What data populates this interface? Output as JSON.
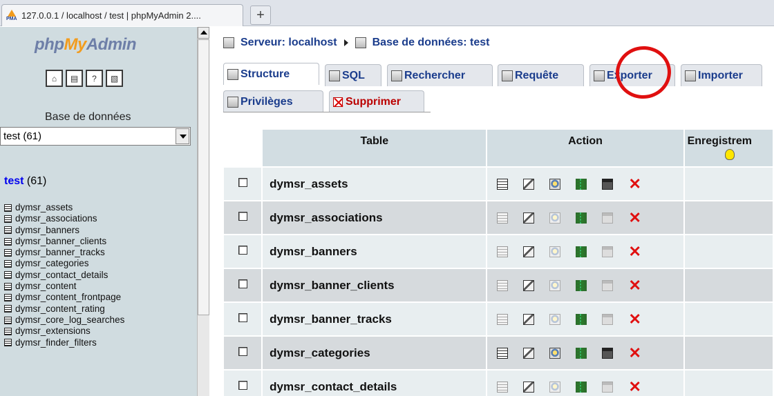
{
  "browser": {
    "tab_title": "127.0.0.1 / localhost / test | phpMyAdmin 2....",
    "favicon_text": "PMA",
    "new_tab_label": "+"
  },
  "left": {
    "logo_php": "php",
    "logo_my": "My",
    "logo_admin": "Admin",
    "toolbar_icons": [
      "home-icon",
      "sql-query-icon",
      "help-icon",
      "documentation-icon"
    ],
    "db_label": "Base de données",
    "db_select_value": "test (61)",
    "db_name": "test",
    "db_count": "(61)",
    "tables": [
      "dymsr_assets",
      "dymsr_associations",
      "dymsr_banners",
      "dymsr_banner_clients",
      "dymsr_banner_tracks",
      "dymsr_categories",
      "dymsr_contact_details",
      "dymsr_content",
      "dymsr_content_frontpage",
      "dymsr_content_rating",
      "dymsr_core_log_searches",
      "dymsr_extensions",
      "dymsr_finder_filters"
    ]
  },
  "breadcrumb": {
    "server": "Serveur: localhost",
    "database": "Base de données: test"
  },
  "tabs": {
    "structure": "Structure",
    "sql": "SQL",
    "search": "Rechercher",
    "query": "Requête",
    "export": "Exporter",
    "import": "Importer",
    "privileges": "Privilèges",
    "drop": "Supprimer"
  },
  "table": {
    "col_table": "Table",
    "col_action": "Action",
    "col_records": "Enregistrem",
    "rows": [
      {
        "name": "dymsr_assets"
      },
      {
        "name": "dymsr_associations"
      },
      {
        "name": "dymsr_banners"
      },
      {
        "name": "dymsr_banner_clients"
      },
      {
        "name": "dymsr_banner_tracks"
      },
      {
        "name": "dymsr_categories"
      },
      {
        "name": "dymsr_contact_details"
      }
    ]
  },
  "colors": {
    "left_bg": "#d0dce0",
    "link_blue": "#1a3c8c",
    "delete_red": "#e01010",
    "annotation_circle": "#e01010"
  }
}
